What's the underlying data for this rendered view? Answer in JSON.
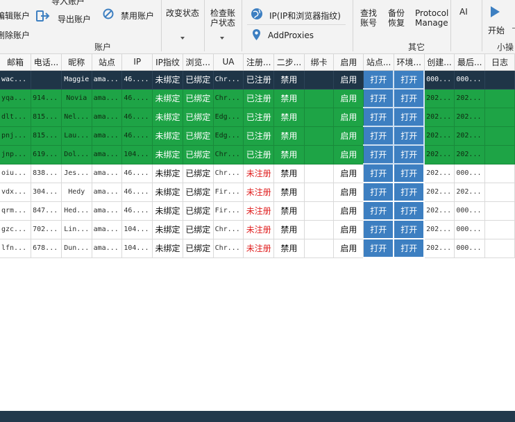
{
  "ribbon": {
    "cut_top_label": "导入账户",
    "edit_account": "编辑账户",
    "delete_account": "删除账户",
    "export_account": "导出账户",
    "disable_account": "禁用账户",
    "group_account": "账户",
    "change_status": "改变状态",
    "check_account_line1": "检查账",
    "check_account_line2": "户状态",
    "ip_fingerprint": "IP(IP和浏览器指纹)",
    "add_proxies": "AddProxies",
    "find_line1": "查找",
    "find_line2": "账号",
    "backup_line1": "备份",
    "backup_line2": "恢复",
    "protocol_line1": "Protocol",
    "protocol_line2": "Manage",
    "ai": "AI",
    "group_other": "其它",
    "start": "开始",
    "group_small": "小操"
  },
  "columns": [
    "邮箱",
    "电话...",
    "昵称",
    "站点",
    "IP",
    "IP指纹",
    "浏览...",
    "UA",
    "注册...",
    "二步...",
    "绑卡",
    "启用",
    "站点...",
    "环境...",
    "创建...",
    "最后...",
    "日志"
  ],
  "rows": [
    {
      "style": "sel",
      "email": "wac...",
      "phone": "",
      "nick": "Maggie",
      "site": "ama...",
      "ip": "46....",
      "ipfp": "未绑定",
      "browser": "已绑定",
      "ua": "Chr...",
      "reg": "已注册",
      "twostep": "禁用",
      "card": "",
      "enable": "启用",
      "site_btn": "打开",
      "env_btn": "打开",
      "created": "000...",
      "last": "000...",
      "log": ""
    },
    {
      "style": "green",
      "email": "yqa...",
      "phone": "914...",
      "nick": "Novia",
      "site": "ama...",
      "ip": "46....",
      "ipfp": "未绑定",
      "browser": "已绑定",
      "ua": "Chr...",
      "reg": "已注册",
      "twostep": "禁用",
      "card": "",
      "enable": "启用",
      "site_btn": "打开",
      "env_btn": "打开",
      "created": "202...",
      "last": "202...",
      "log": ""
    },
    {
      "style": "green",
      "email": "dlt...",
      "phone": "815...",
      "nick": "Nel...",
      "site": "ama...",
      "ip": "46....",
      "ipfp": "未绑定",
      "browser": "已绑定",
      "ua": "Edg...",
      "reg": "已注册",
      "twostep": "禁用",
      "card": "",
      "enable": "启用",
      "site_btn": "打开",
      "env_btn": "打开",
      "created": "202...",
      "last": "202...",
      "log": ""
    },
    {
      "style": "green",
      "email": "pnj...",
      "phone": "815...",
      "nick": "Lau...",
      "site": "ama...",
      "ip": "46....",
      "ipfp": "未绑定",
      "browser": "已绑定",
      "ua": "Edg...",
      "reg": "已注册",
      "twostep": "禁用",
      "card": "",
      "enable": "启用",
      "site_btn": "打开",
      "env_btn": "打开",
      "created": "202...",
      "last": "202...",
      "log": ""
    },
    {
      "style": "green",
      "email": "jnp...",
      "phone": "619...",
      "nick": "Dol...",
      "site": "ama...",
      "ip": "104...",
      "ipfp": "未绑定",
      "browser": "已绑定",
      "ua": "Chr...",
      "reg": "已注册",
      "twostep": "禁用",
      "card": "",
      "enable": "启用",
      "site_btn": "打开",
      "env_btn": "打开",
      "created": "202...",
      "last": "202...",
      "log": ""
    },
    {
      "style": "white",
      "email": "oiu...",
      "phone": "838...",
      "nick": "Jes...",
      "site": "ama...",
      "ip": "46....",
      "ipfp": "未绑定",
      "browser": "已绑定",
      "ua": "Chr...",
      "reg": "未注册",
      "twostep": "禁用",
      "card": "",
      "enable": "启用",
      "site_btn": "打开",
      "env_btn": "打开",
      "created": "202...",
      "last": "000...",
      "log": ""
    },
    {
      "style": "white",
      "email": "vdx...",
      "phone": "304...",
      "nick": "Hedy",
      "site": "ama...",
      "ip": "46....",
      "ipfp": "未绑定",
      "browser": "已绑定",
      "ua": "Fir...",
      "reg": "未注册",
      "twostep": "禁用",
      "card": "",
      "enable": "启用",
      "site_btn": "打开",
      "env_btn": "打开",
      "created": "202...",
      "last": "202...",
      "log": ""
    },
    {
      "style": "white",
      "email": "qrm...",
      "phone": "847...",
      "nick": "Hed...",
      "site": "ama...",
      "ip": "46....",
      "ipfp": "未绑定",
      "browser": "已绑定",
      "ua": "Fir...",
      "reg": "未注册",
      "twostep": "禁用",
      "card": "",
      "enable": "启用",
      "site_btn": "打开",
      "env_btn": "打开",
      "created": "202...",
      "last": "000...",
      "log": ""
    },
    {
      "style": "white",
      "email": "gzc...",
      "phone": "702...",
      "nick": "Lin...",
      "site": "ama...",
      "ip": "104...",
      "ipfp": "未绑定",
      "browser": "已绑定",
      "ua": "Chr...",
      "reg": "未注册",
      "twostep": "禁用",
      "card": "",
      "enable": "启用",
      "site_btn": "打开",
      "env_btn": "打开",
      "created": "202...",
      "last": "000...",
      "log": ""
    },
    {
      "style": "white",
      "email": "lfn...",
      "phone": "678...",
      "nick": "Dun...",
      "site": "ama...",
      "ip": "104...",
      "ipfp": "未绑定",
      "browser": "已绑定",
      "ua": "Chr...",
      "reg": "未注册",
      "twostep": "禁用",
      "card": "",
      "enable": "启用",
      "site_btn": "打开",
      "env_btn": "打开",
      "created": "202...",
      "last": "000...",
      "log": ""
    }
  ],
  "colors": {
    "selected_row": "#1f3547",
    "active_row": "#1ea446",
    "button_blue": "#3d7fc1",
    "unregistered_red": "#e02020",
    "status_bar": "#22394c"
  }
}
